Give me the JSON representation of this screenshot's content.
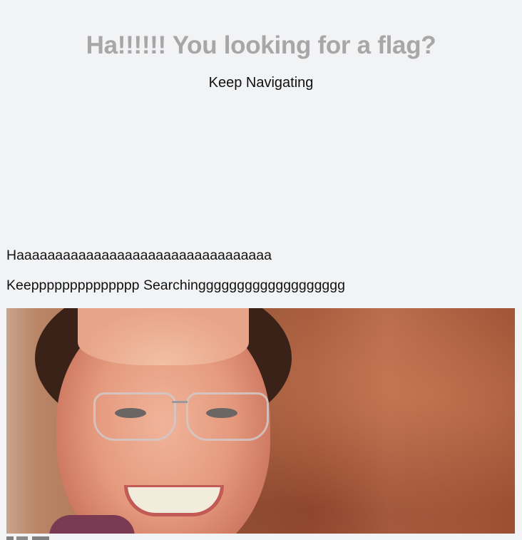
{
  "header": {
    "title": "Ha!!!!!! You looking for a flag?",
    "subtitle": "Keep Navigating"
  },
  "content": {
    "line1": "Haaaaaaaaaaaaaaaaaaaaaaaaaaaaaaaaa",
    "line2": "Keepppppppppppppp Searchinggggggggggggggggggg"
  },
  "image": {
    "subject": "smiling-man-with-glasses-photo"
  }
}
